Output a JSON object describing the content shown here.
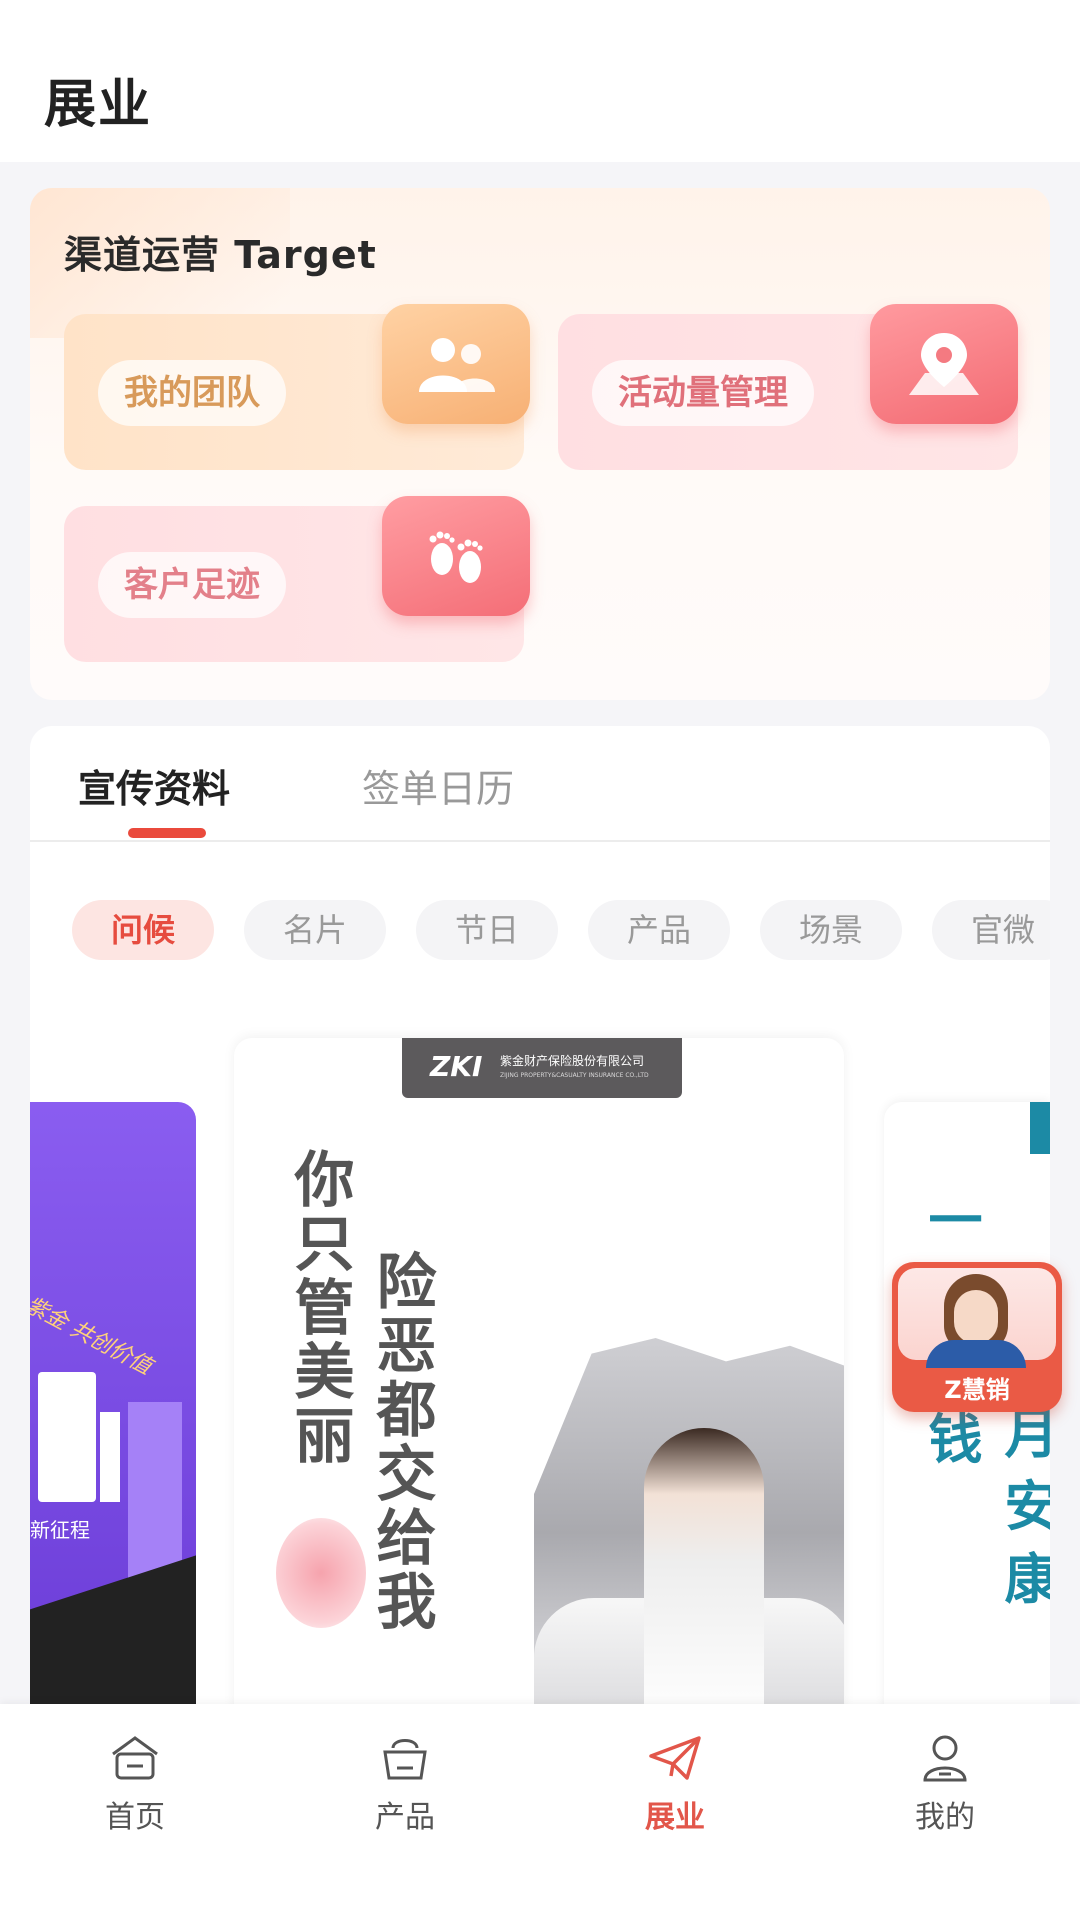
{
  "header": {
    "title": "展业"
  },
  "ops": {
    "title": "渠道运营 Target",
    "tiles": [
      {
        "label": "我的团队",
        "icon": "team-icon"
      },
      {
        "label": "活动量管理",
        "icon": "location-pin-icon"
      },
      {
        "label": "客户足迹",
        "icon": "footprints-icon"
      }
    ]
  },
  "materials": {
    "tabs": [
      {
        "label": "宣传资料",
        "active": true
      },
      {
        "label": "签单日历",
        "active": false
      }
    ],
    "categories": [
      {
        "label": "问候",
        "active": true
      },
      {
        "label": "名片"
      },
      {
        "label": "节日"
      },
      {
        "label": "产品"
      },
      {
        "label": "场景"
      },
      {
        "label": "官微"
      }
    ],
    "posters": {
      "left": {
        "slogan": "紫金 共创价值",
        "sub": "新征程"
      },
      "main": {
        "logo_mark": "ZKI",
        "logo_company": "紫金财产保险股份有限公司",
        "logo_english": "ZIJING PROPERTY&CASUALTY INSURANCE CO.,LTD",
        "line1": "你只管美丽",
        "line2": "险恶都交给我"
      },
      "right": {
        "line1": "一 打 东 钱",
        "line2": "月 月 安 康"
      }
    }
  },
  "assistant": {
    "label": "Z慧销"
  },
  "nav": {
    "items": [
      {
        "label": "首页",
        "icon": "home-icon",
        "active": false
      },
      {
        "label": "产品",
        "icon": "bag-icon",
        "active": false
      },
      {
        "label": "展业",
        "icon": "paper-plane-icon",
        "active": true
      },
      {
        "label": "我的",
        "icon": "user-icon",
        "active": false
      }
    ]
  },
  "colors": {
    "accent": "#ea4a3c",
    "brand_teal": "#1c8aa5",
    "poster_purple": "#7a4be6"
  }
}
